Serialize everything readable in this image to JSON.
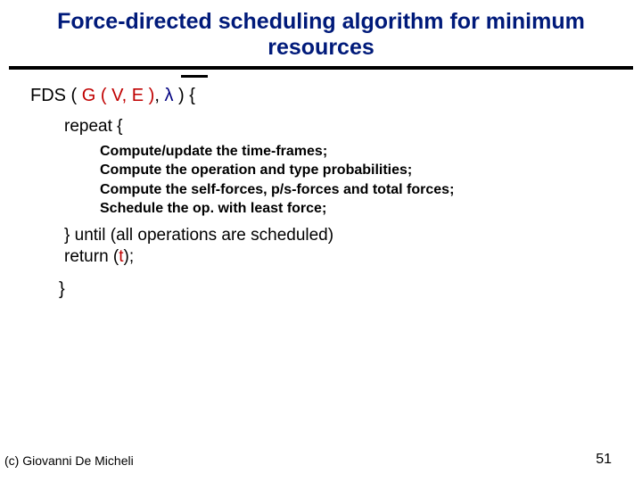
{
  "title": "Force-directed scheduling algorithm for minimum resources",
  "sig": {
    "prefix": "FDS ( ",
    "graph_open": "G ( ",
    "v": "V, ",
    "e": "E ",
    "graph_close": ")",
    "sep": ",  ",
    "lambda": "λ",
    "suffix": " ) {"
  },
  "repeat_open": "repeat {",
  "steps": [
    "Compute/update the time-frames;",
    "Compute the operation and type probabilities;",
    "Compute the self-forces, p/s-forces and total forces;",
    "Schedule the op. with least force;"
  ],
  "until": "} until (all operations are scheduled)",
  "return_prefix": "return (",
  "return_t": "t",
  "return_suffix": ");",
  "close_brace": "}",
  "footer_left": "(c)  Giovanni De Micheli",
  "footer_right": "51"
}
